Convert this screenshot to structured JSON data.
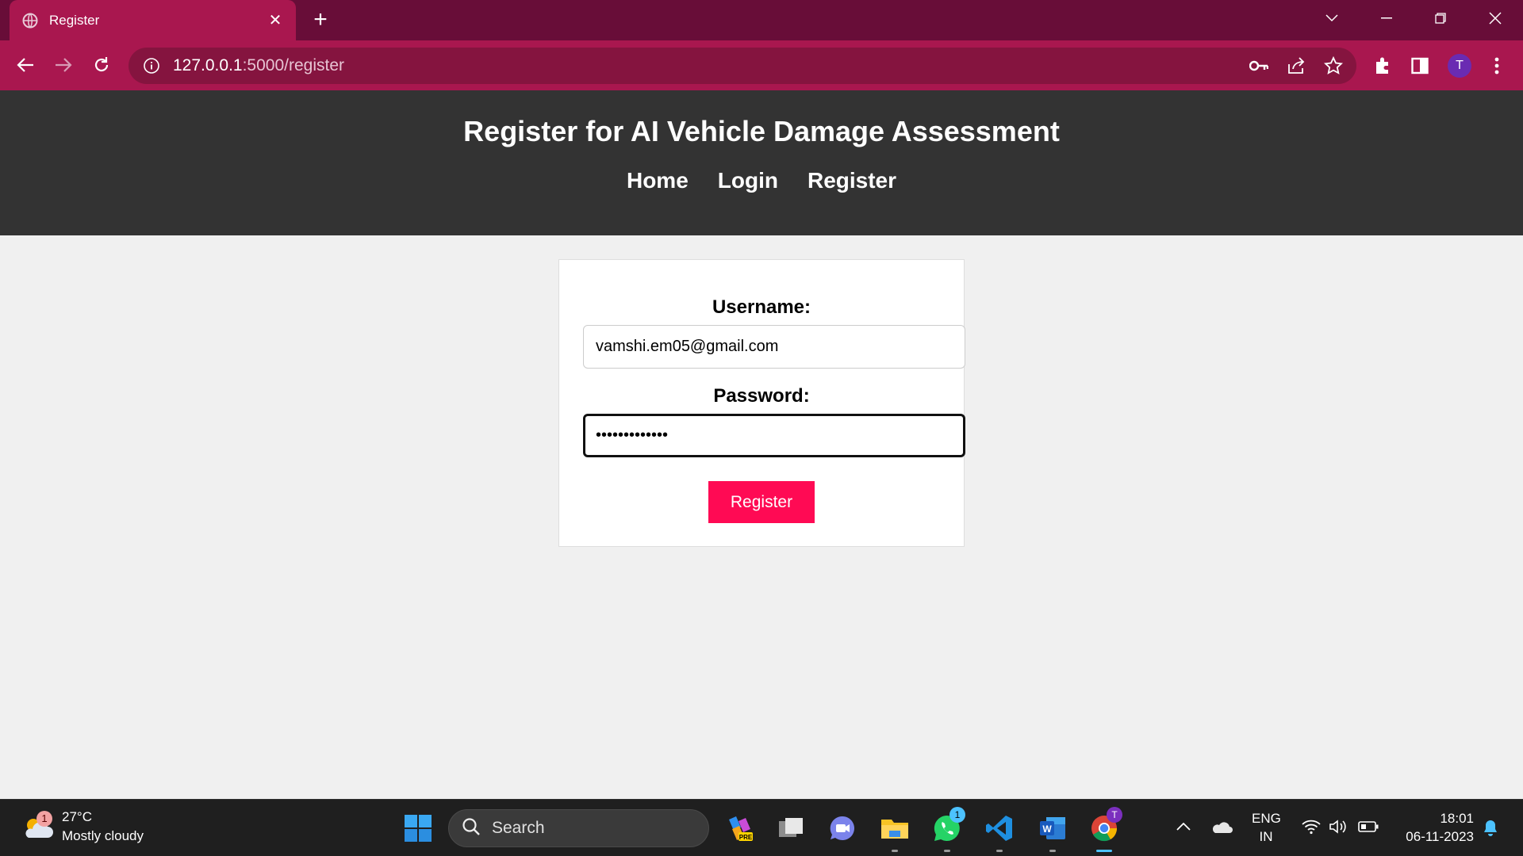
{
  "browser": {
    "tab_title": "Register",
    "url_host": "127.0.0.1",
    "url_path": ":5000/register",
    "profile_initial": "T"
  },
  "page": {
    "title": "Register for AI Vehicle Damage Assessment",
    "nav": [
      "Home",
      "Login",
      "Register"
    ],
    "form": {
      "username_label": "Username:",
      "username_value": "vamshi.em05@gmail.com",
      "password_label": "Password:",
      "password_value": "•••••••••••••",
      "submit_label": "Register"
    },
    "colors": {
      "header_bg": "#333333",
      "button_bg": "#ff0a54",
      "browser_tab": "#a9174f",
      "browser_frame": "#680d38"
    }
  },
  "taskbar": {
    "weather_temp": "27°C",
    "weather_desc": "Mostly cloudy",
    "weather_badge": "1",
    "search_label": "Search",
    "whatsapp_badge": "1",
    "chrome_profile_badge": "T",
    "lang_line1": "ENG",
    "lang_line2": "IN",
    "time": "18:01",
    "date": "06-11-2023"
  }
}
